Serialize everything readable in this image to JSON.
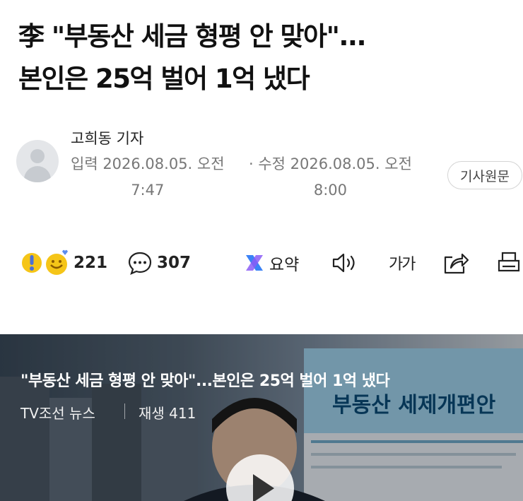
{
  "article": {
    "headline_line1": "李 \"부동산 세금 형평 안 맞아\"...",
    "headline_line2": "본인은 25억 벌어 1억 냈다",
    "reporter": "고희동 기자",
    "input_label": "입력 2026.08.05. 오전",
    "input_time": "7:47",
    "edit_label": "· 수정 2026.08.05. 오전",
    "edit_time": "8:00",
    "original_button": "기사원문"
  },
  "toolbar": {
    "reactions_count": "221",
    "comments_count": "307",
    "summary_label": "요약",
    "font_size_label": "가가"
  },
  "video": {
    "title": "\"부동산 세금 형평 안 맞아\"...본인은 25억 벌어 1억 냈다",
    "source": "TV조선 뉴스",
    "plays": "재생 411",
    "background_sign_text": "부동산 세제개편안"
  },
  "colors": {
    "summary_icon": "#3b82f6",
    "reaction_yellow": "#f5c518",
    "reaction_blue": "#5b8def"
  }
}
